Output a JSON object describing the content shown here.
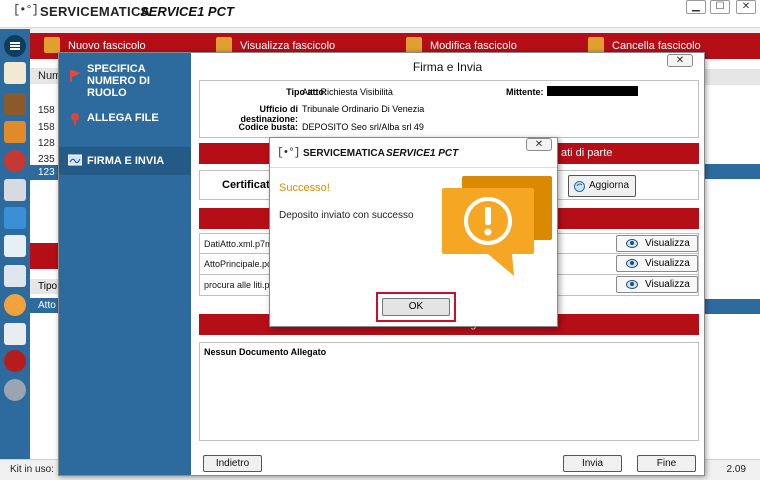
{
  "app": {
    "brand_name": "SERVICEMATICA",
    "product_name": "SERVICE1 PCT",
    "logo_text": "[•°]"
  },
  "window_controls": {
    "minimize": "▁",
    "maximize": "☐",
    "close": "✕"
  },
  "toolbar": {
    "items": [
      {
        "label": "Nuovo fascicolo"
      },
      {
        "label": "Visualizza fascicolo"
      },
      {
        "label": "Modifica fascicolo"
      },
      {
        "label": "Cancella fascicolo"
      }
    ]
  },
  "background_list": {
    "column_header": "Num",
    "rows": [
      "158",
      "158",
      "128",
      "235",
      "123"
    ],
    "lower_header": "Tipo",
    "lower_row": "Atto"
  },
  "status_bar": {
    "left": "Kit in uso:",
    "right": "2.09"
  },
  "dialog": {
    "title": "Firma e Invia",
    "close_label": "✕",
    "steps": [
      {
        "label": "SPECIFICA NUMERO DI RUOLO",
        "line1": "SPECIFICA",
        "line2": "NUMERO DI RUOLO"
      },
      {
        "label": "ALLEGA FILE"
      },
      {
        "label": "FIRMA E INVIA"
      }
    ],
    "info": {
      "tipo_atto_label": "Tipo atto:",
      "tipo_atto_value": "Atto Richiesta Visibilità",
      "ufficio_label": "Ufficio di destinazione:",
      "ufficio_value": "Tribunale Ordinario Di Venezia",
      "codice_label": "Codice busta:",
      "codice_value": "DEPOSITO Seo srl/Alba srl 49",
      "mittente_label": "Mittente:"
    },
    "section_partial_title": "ati di parte",
    "certificate_label": "Certificat",
    "aggiorna_label": "Aggiorna",
    "files": [
      {
        "name": "DatiAtto.xml.p7m",
        "action": "Visualizza"
      },
      {
        "name": "AttoPrincipale.pc",
        "action": "Visualizza"
      },
      {
        "name": "procura alle liti.p",
        "action": "Visualizza"
      }
    ],
    "allegati_title": "Documenti Allegati",
    "allegati_empty": "Nessun Documento Allegato",
    "buttons": {
      "back": "Indietro",
      "send": "Invia",
      "finish": "Fine"
    }
  },
  "popup": {
    "brand_name": "SERVICEMATICA",
    "product_name": "SERVICE1 PCT",
    "close_label": "✕",
    "heading": "Successo!",
    "message": "Deposito inviato con successo",
    "ok_label": "OK",
    "icon": "exclamation-speech-bubble-icon",
    "accent_color": "#f5a623",
    "highlight_color": "#c8102e"
  },
  "colors": {
    "brand_red": "#b50e17",
    "rail_blue": "#2d6b9f",
    "selection_blue": "#2d6b9f"
  }
}
